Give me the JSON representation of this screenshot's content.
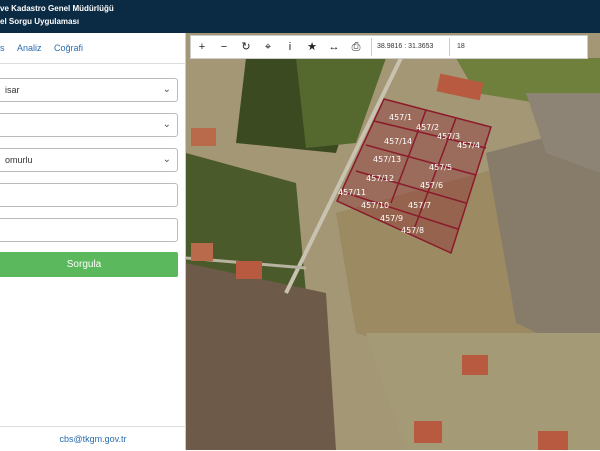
{
  "header": {
    "title_line1": "ve Kadastro Genel Müdürlüğü",
    "title_line2": "el Sorgu Uygulaması"
  },
  "tabs": [
    {
      "label": "s"
    },
    {
      "label": "Analiz"
    },
    {
      "label": "Coğrafi"
    }
  ],
  "form": {
    "select1": "isar",
    "select2": "",
    "select3": "omurlu",
    "input1": "",
    "input2": "",
    "submit_label": "Sorgula"
  },
  "footer": {
    "email": "cbs@tkgm.gov.tr"
  },
  "toolbar": {
    "tools": [
      {
        "name": "zoom-in-icon",
        "glyph": "+"
      },
      {
        "name": "zoom-out-icon",
        "glyph": "−"
      },
      {
        "name": "refresh-icon",
        "glyph": "↻"
      },
      {
        "name": "locate-icon",
        "glyph": "⌖"
      },
      {
        "name": "info-icon",
        "glyph": "i"
      },
      {
        "name": "favorite-icon",
        "glyph": "★"
      },
      {
        "name": "measure-icon",
        "glyph": "↔"
      },
      {
        "name": "print-icon",
        "glyph": "⎙"
      }
    ],
    "coordinates": "38.9816 : 31.3653",
    "zoom_level": "18"
  },
  "parcels": [
    {
      "label": "457/1"
    },
    {
      "label": "457/2"
    },
    {
      "label": "457/3"
    },
    {
      "label": "457/4"
    },
    {
      "label": "457/14"
    },
    {
      "label": "457/13"
    },
    {
      "label": "457/5"
    },
    {
      "label": "457/12"
    },
    {
      "label": "457/6"
    },
    {
      "label": "457/11"
    },
    {
      "label": "457/10"
    },
    {
      "label": "457/7"
    },
    {
      "label": "457/9"
    },
    {
      "label": "457/8"
    }
  ],
  "colors": {
    "header_bg": "#0b2a44",
    "accent": "#2b6cb0",
    "button": "#5cb85c",
    "parcel_outline": "#8b1a2b"
  }
}
